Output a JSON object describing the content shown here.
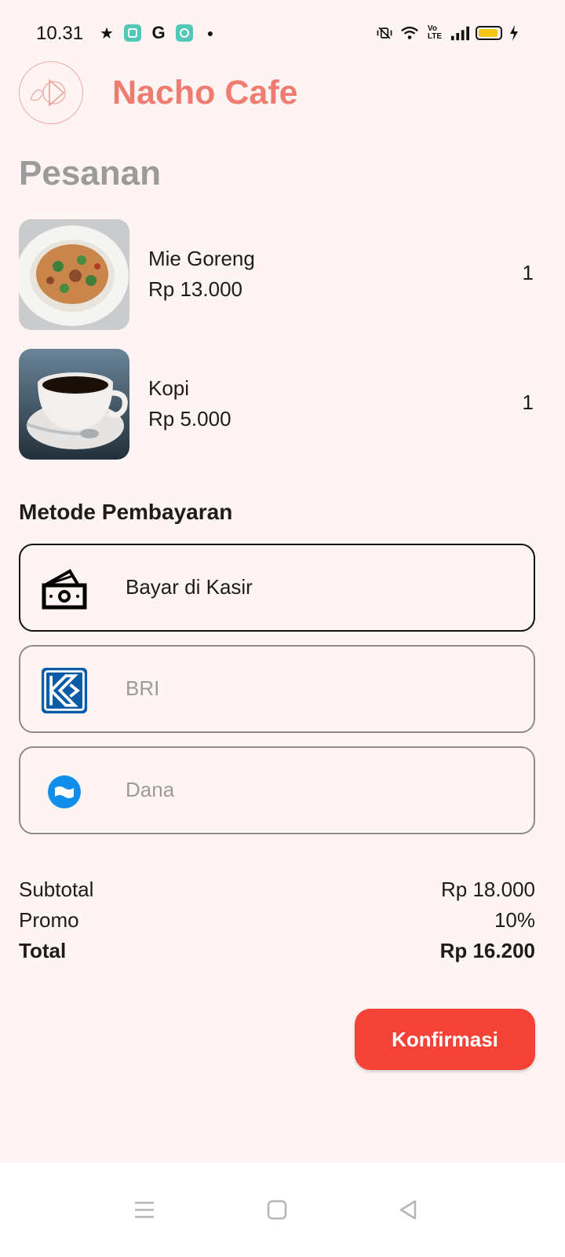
{
  "status_bar": {
    "time": "10.31",
    "left_icons": [
      "star-icon",
      "app-icon",
      "google-icon",
      "app2-icon",
      "dot-icon"
    ],
    "right_icons": [
      "vibrate-icon",
      "wifi-icon",
      "volte-icon",
      "signal-icon",
      "battery-icon",
      "charging-icon"
    ]
  },
  "header": {
    "app_title": "Nacho Cafe",
    "logo_icon": "play-logo-icon"
  },
  "orders": {
    "section_title": "Pesanan",
    "items": [
      {
        "name": "Mie Goreng",
        "price": "Rp 13.000",
        "qty": "1",
        "image": "fried-noodles-photo"
      },
      {
        "name": "Kopi",
        "price": "Rp 5.000",
        "qty": "1",
        "image": "coffee-cup-photo"
      }
    ]
  },
  "payment": {
    "section_title": "Metode Pembayaran",
    "options": [
      {
        "label": "Bayar di Kasir",
        "icon": "cash-icon",
        "selected": true
      },
      {
        "label": "BRI",
        "icon": "bri-logo-icon",
        "selected": false
      },
      {
        "label": "Dana",
        "icon": "dana-logo-icon",
        "selected": false
      }
    ]
  },
  "summary": {
    "subtotal_label": "Subtotal",
    "subtotal_value": "Rp 18.000",
    "promo_label": "Promo",
    "promo_value": "10%",
    "total_label": "Total",
    "total_value": "Rp 16.200"
  },
  "confirm_button": {
    "label": "Konfirmasi"
  },
  "colors": {
    "background": "#fdf4f3",
    "brand": "#ef7c70",
    "button": "#f44336",
    "muted": "#9c9a9a"
  },
  "nav_bar": {
    "icons": [
      "menu-icon",
      "home-icon",
      "back-icon"
    ]
  }
}
